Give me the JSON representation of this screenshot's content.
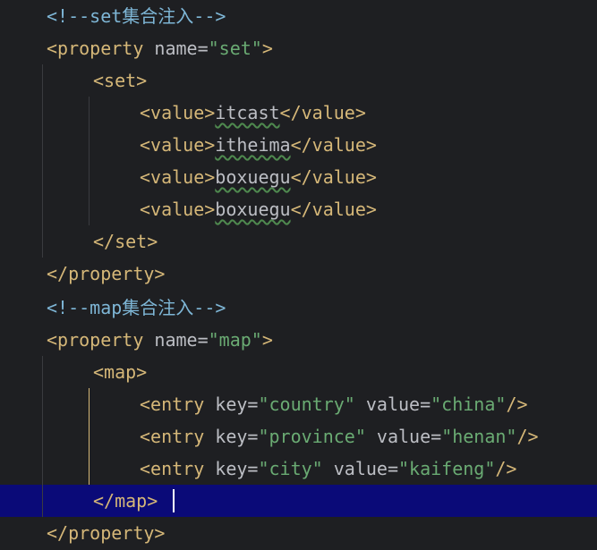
{
  "editor": {
    "lines": [
      {
        "id": "l1",
        "parts": [
          [
            "comment",
            "<!--set集合注入-->"
          ]
        ]
      },
      {
        "id": "l2",
        "parts": [
          [
            "tag",
            "<property "
          ],
          [
            "attr",
            "name"
          ],
          [
            "eq",
            "="
          ],
          [
            "str",
            "\"set\""
          ],
          [
            "tag",
            ">"
          ]
        ]
      },
      {
        "id": "l3",
        "parts": [
          [
            "tag",
            "<set>"
          ]
        ]
      },
      {
        "id": "l4",
        "parts": [
          [
            "tag",
            "<value>"
          ],
          [
            "text",
            "itcast"
          ],
          [
            "tag",
            "</value>"
          ]
        ]
      },
      {
        "id": "l5",
        "parts": [
          [
            "tag",
            "<value>"
          ],
          [
            "text",
            "itheima"
          ],
          [
            "tag",
            "</value>"
          ]
        ]
      },
      {
        "id": "l6",
        "parts": [
          [
            "tag",
            "<value>"
          ],
          [
            "text",
            "boxuegu"
          ],
          [
            "tag",
            "</value>"
          ]
        ]
      },
      {
        "id": "l7",
        "parts": [
          [
            "tag",
            "<value>"
          ],
          [
            "text",
            "boxuegu"
          ],
          [
            "tag",
            "</value>"
          ]
        ]
      },
      {
        "id": "l8",
        "parts": [
          [
            "tag",
            "</set>"
          ]
        ]
      },
      {
        "id": "l9",
        "parts": [
          [
            "tag",
            "</property>"
          ]
        ]
      },
      {
        "id": "l10",
        "parts": [
          [
            "comment",
            "<!--map集合注入-->"
          ]
        ]
      },
      {
        "id": "l11",
        "parts": [
          [
            "tag",
            "<property "
          ],
          [
            "attr",
            "name"
          ],
          [
            "eq",
            "="
          ],
          [
            "str",
            "\"map\""
          ],
          [
            "tag",
            ">"
          ]
        ]
      },
      {
        "id": "l12",
        "parts": [
          [
            "tag",
            "<map>"
          ]
        ]
      },
      {
        "id": "l13",
        "parts": [
          [
            "tag",
            "<entry "
          ],
          [
            "attr",
            "key"
          ],
          [
            "eq",
            "="
          ],
          [
            "str",
            "\"country\""
          ],
          [
            "attr",
            " value"
          ],
          [
            "eq",
            "="
          ],
          [
            "str",
            "\"china\""
          ],
          [
            "tag",
            "/>"
          ]
        ]
      },
      {
        "id": "l14",
        "parts": [
          [
            "tag",
            "<entry "
          ],
          [
            "attr",
            "key"
          ],
          [
            "eq",
            "="
          ],
          [
            "str",
            "\"province\""
          ],
          [
            "attr",
            " value"
          ],
          [
            "eq",
            "="
          ],
          [
            "str",
            "\"henan\""
          ],
          [
            "tag",
            "/>"
          ]
        ]
      },
      {
        "id": "l15",
        "parts": [
          [
            "tag",
            "<entry "
          ],
          [
            "attr",
            "key"
          ],
          [
            "eq",
            "="
          ],
          [
            "str",
            "\"city\""
          ],
          [
            "attr",
            " value"
          ],
          [
            "eq",
            "="
          ],
          [
            "str",
            "\"kaifeng\""
          ],
          [
            "tag",
            "/>"
          ]
        ]
      },
      {
        "id": "l16",
        "parts": [
          [
            "tag",
            "</map>"
          ]
        ]
      },
      {
        "id": "l17",
        "parts": [
          [
            "tag",
            "</property>"
          ]
        ]
      }
    ],
    "current_line": 16
  }
}
